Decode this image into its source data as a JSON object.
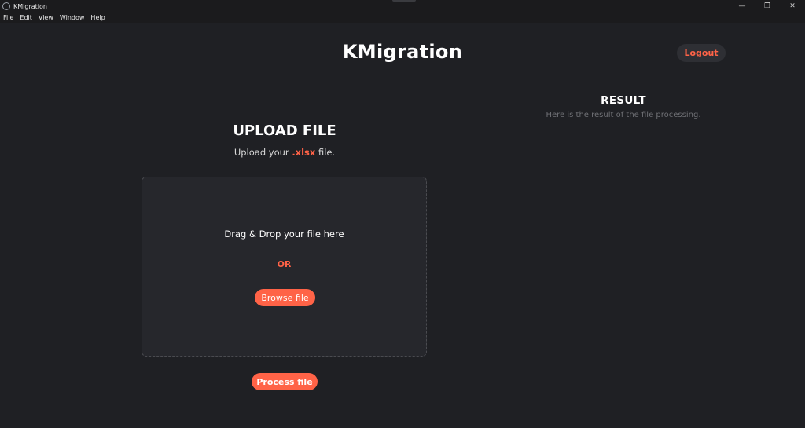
{
  "window": {
    "title": "KMigration",
    "controls": {
      "minimize": "—",
      "restore": "❐",
      "close": "✕"
    }
  },
  "menu": {
    "items": [
      "File",
      "Edit",
      "View",
      "Window",
      "Help"
    ]
  },
  "header": {
    "title": "KMigration",
    "logout_label": "Logout"
  },
  "upload": {
    "title": "UPLOAD FILE",
    "subtitle_prefix": "Upload your ",
    "subtitle_ext": ".xlsx",
    "subtitle_suffix": " file.",
    "drop_text": "Drag & Drop your file here",
    "or_text": "OR",
    "browse_label": "Browse file",
    "process_label": "Process file"
  },
  "result": {
    "title": "RESULT",
    "subtitle": "Here is the result of the file processing."
  },
  "colors": {
    "accent": "#ff6347",
    "background": "#1f2024",
    "dropzone": "#26272c"
  }
}
